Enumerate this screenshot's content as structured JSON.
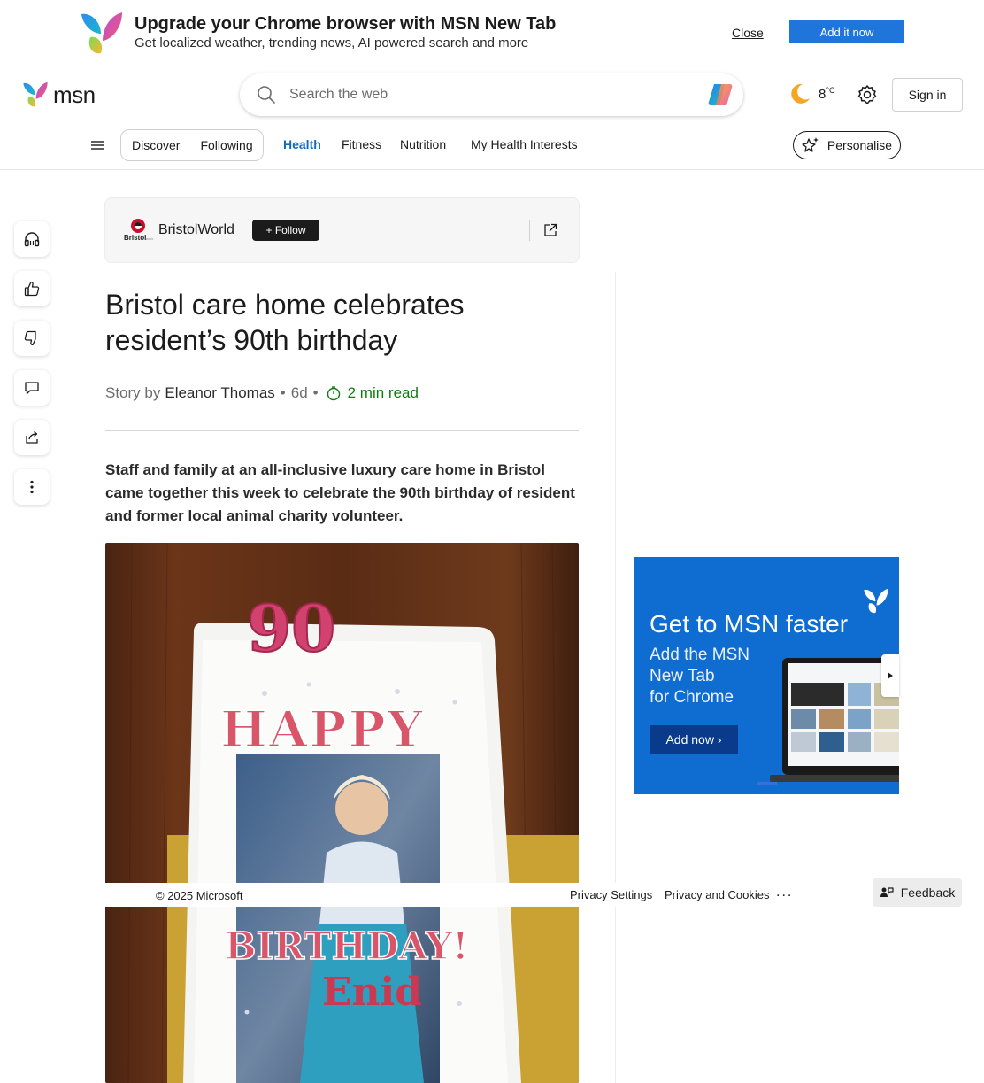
{
  "promo": {
    "title": "Upgrade your Chrome browser with MSN New Tab",
    "subtitle": "Get localized weather, trending news, AI powered search and more",
    "close_label": "Close",
    "add_label": "Add it now"
  },
  "header": {
    "logo_text": "msn",
    "search_placeholder": "Search the web",
    "weather_temp": "8",
    "weather_unit": "°C",
    "weather_icon": "moon-icon",
    "signin_label": "Sign in"
  },
  "nav": {
    "pill_items": [
      "Discover",
      "Following"
    ],
    "items": [
      "Health",
      "Fitness",
      "Nutrition",
      "My Health Interests"
    ],
    "active": "Health",
    "personalise_label": "Personalise"
  },
  "rail": [
    "headphones-icon",
    "like-icon",
    "dislike-icon",
    "comment-icon",
    "share-icon",
    "more-icon"
  ],
  "publisher": {
    "logo_text": "Bristol",
    "name": "BristolWorld",
    "follow_label": "+ Follow"
  },
  "article": {
    "headline": "Bristol care home celebrates resident’s 90th birthday",
    "story_by": "Story by",
    "author": "Eleanor Thomas",
    "age": "6d",
    "read_time": "2 min read",
    "lede": "Staff and family at an all-inclusive luxury care home in Bristol came together this week to celebrate the 90th birthday of resident and former local animal charity volunteer.",
    "cake_candles": "90",
    "cake_happy": "HAPPY",
    "cake_birthday": "BIRTHDAY!",
    "cake_name": "Enid"
  },
  "ad": {
    "title": "Get to MSN faster",
    "lines": [
      "Add the MSN",
      "New Tab",
      "for Chrome"
    ],
    "button_label": "Add now ›"
  },
  "footer": {
    "copyright": "© 2025 Microsoft",
    "links": [
      "Privacy Settings",
      "Privacy and Cookies"
    ],
    "more": "...",
    "feedback_label": "Feedback"
  },
  "colors": {
    "accent": "#0f6cbd",
    "read_time": "#107c10",
    "promo_button": "#1f75d9",
    "ad_background": "#0f6cd0"
  }
}
